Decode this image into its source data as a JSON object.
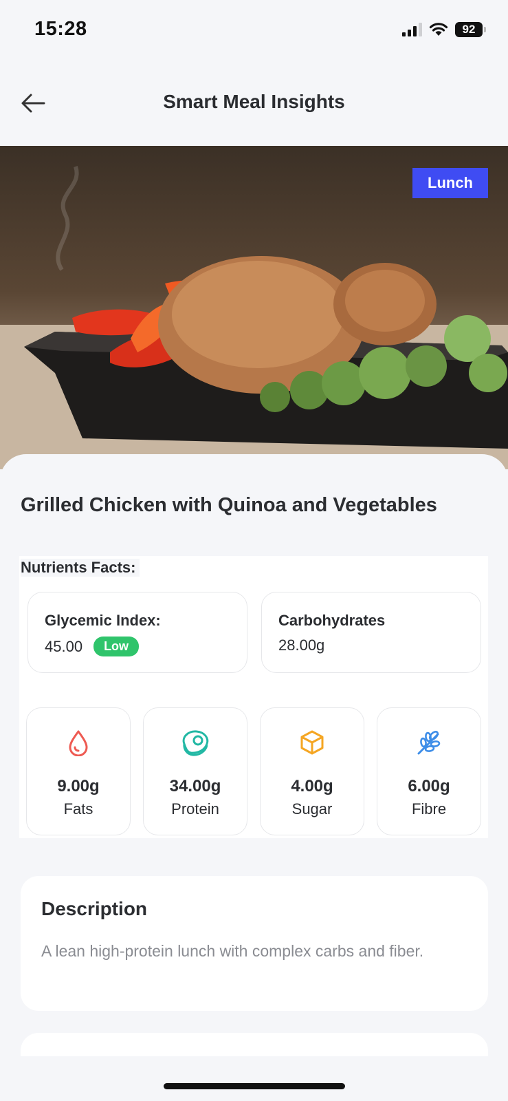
{
  "status_bar": {
    "time": "15:28",
    "battery": "92"
  },
  "header": {
    "title": "Smart Meal Insights"
  },
  "hero": {
    "meal_type": "Lunch"
  },
  "meal": {
    "title": "Grilled Chicken with Quinoa and Vegetables"
  },
  "nutrients": {
    "heading": "Nutrients Facts:",
    "glycemic_index": {
      "label": "Glycemic Index:",
      "value": "45.00",
      "level": "Low"
    },
    "carbohydrates": {
      "label": "Carbohydrates",
      "value": "28.00g"
    },
    "items": [
      {
        "amount": "9.00g",
        "name": "Fats",
        "icon": "drop-icon",
        "color": "#ee5a52"
      },
      {
        "amount": "34.00g",
        "name": "Protein",
        "icon": "meat-icon",
        "color": "#22b8a4"
      },
      {
        "amount": "4.00g",
        "name": "Sugar",
        "icon": "cube-icon",
        "color": "#f5a623"
      },
      {
        "amount": "6.00g",
        "name": "Fibre",
        "icon": "wheat-icon",
        "color": "#3d8de8"
      }
    ]
  },
  "description": {
    "title": "Description",
    "text": "A lean high-protein lunch with complex carbs and fiber."
  },
  "colors": {
    "accent": "#3f4cf3",
    "low_badge": "#2fc46b"
  }
}
